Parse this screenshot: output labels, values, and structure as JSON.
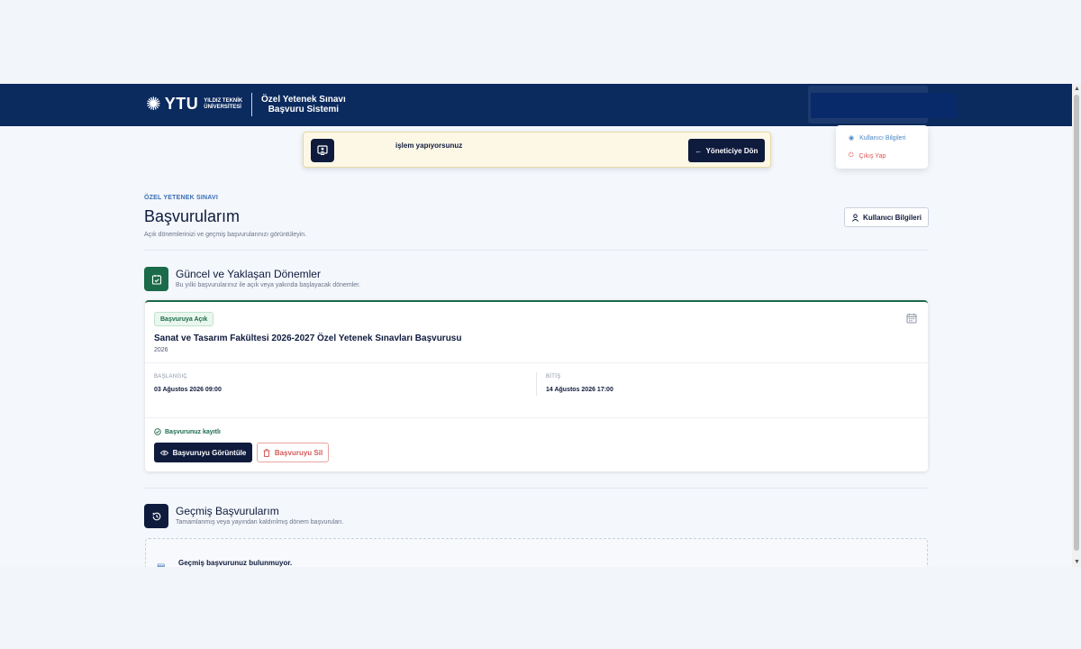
{
  "header": {
    "logo_text": "YTU",
    "university_line1": "YILDIZ TEKNİK",
    "university_line2": "ÜNİVERSİTESİ",
    "system_title_line1": "Özel Yetenek Sınavı",
    "system_title_line2": "Başvuru Sistemi"
  },
  "user_menu": {
    "info_label": "Kullanıcı Bilgileri",
    "logout_label": "Çıkış Yap"
  },
  "impersonation": {
    "message": "işlem yapıyorsunuz",
    "back_button": "Yöneticiye Dön",
    "back_arrow": "←"
  },
  "page": {
    "eyebrow": "ÖZEL YETENEK SINAVI",
    "title": "Başvurularım",
    "subtitle": "Açık dönemlerinizi ve geçmiş başvurularınızı görüntüleyin.",
    "user_info_button": "Kullanıcı Bilgileri"
  },
  "current_section": {
    "title": "Güncel ve Yaklaşan Dönemler",
    "subtitle": "Bu yılki başvurularınız ile açık veya yakında başlayacak dönemler."
  },
  "period_card": {
    "status_badge": "Başvuruya Açık",
    "title": "Sanat ve Tasarım Fakültesi 2026-2027 Özel Yetenek Sınavları Başvurusu",
    "year": "2026",
    "start_label": "BAŞLANGIÇ",
    "start_value": "03 Ağustos 2026 09:00",
    "end_label": "BİTİŞ",
    "end_value": "14 Ağustos 2026 17:00",
    "registration_status": "Başvurunuz kayıtlı",
    "view_button": "Başvuruyu Görüntüle",
    "delete_button": "Başvuruyu Sil"
  },
  "past_section": {
    "title": "Geçmiş Başvurularım",
    "subtitle": "Tamamlanmış veya yayından kaldırılmış dönem başvuruları.",
    "empty_text": "Geçmiş başvurunuz bulunmuyor."
  },
  "colors": {
    "navy": "#0b2a5e",
    "dark_button": "#0f1b3d",
    "success_green": "#1b6b4a",
    "danger_red": "#d65a5a",
    "link_blue": "#3a6fb6",
    "warning_bg": "#fdf8e6"
  },
  "icons": {
    "impersonation": "user-screen-icon",
    "user_info": "user-icon",
    "logout": "power-icon",
    "current_section": "calendar-check-icon",
    "past_section": "history-icon",
    "card_calendar": "calendar-icon",
    "registered": "check-circle-icon",
    "view": "eye-icon",
    "delete": "trash-icon",
    "empty": "document-icon"
  }
}
